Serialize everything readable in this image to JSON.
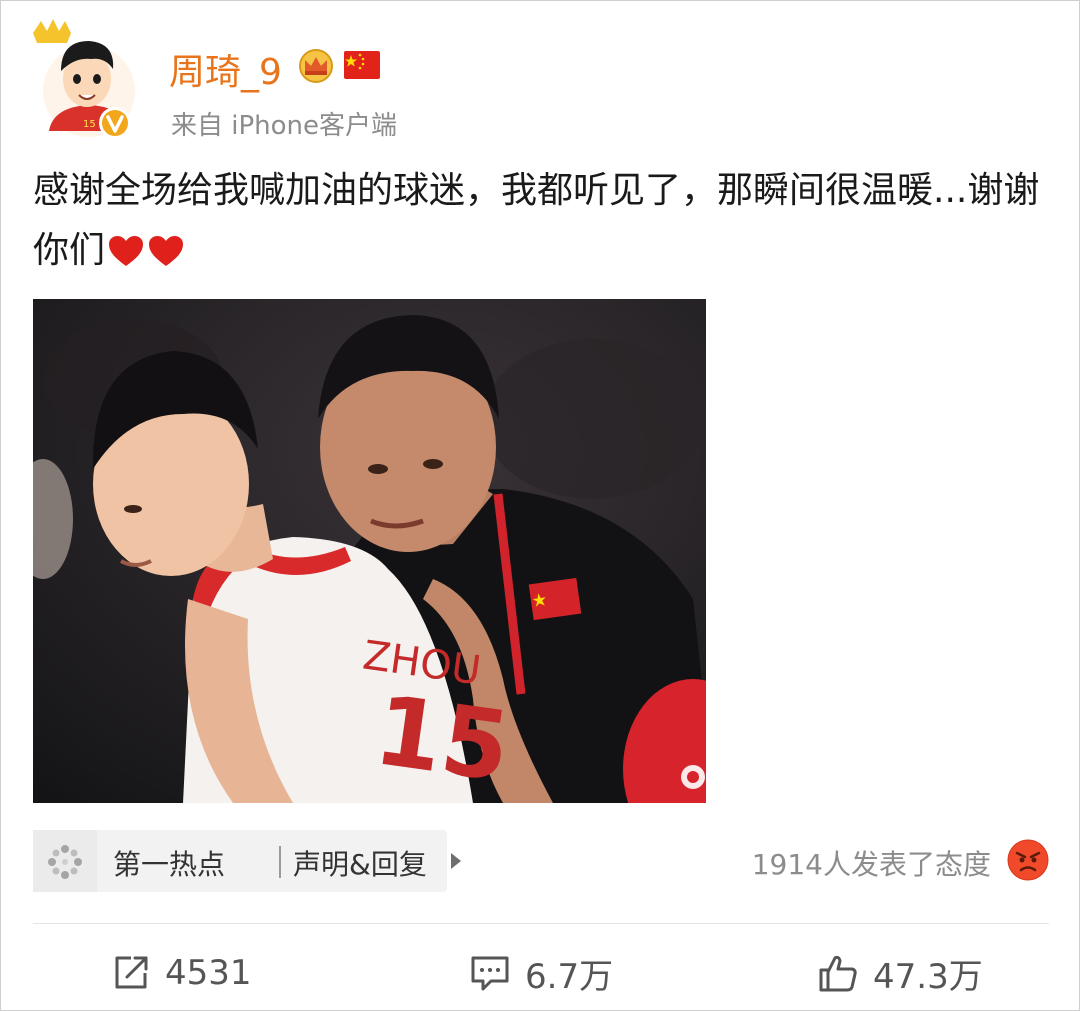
{
  "user": {
    "name": "周琦_9",
    "source": "来自 iPhone客户端"
  },
  "post": {
    "text": "感谢全场给我喊加油的球迷，我都听见了，那瞬间很温暖...谢谢你们"
  },
  "topic": {
    "label": "第一热点",
    "link_label": "声明&回复"
  },
  "reactions": {
    "summary": "1914人发表了态度"
  },
  "actions": {
    "repost_count": "4531",
    "comment_count": "6.7万",
    "like_count": "47.3万"
  },
  "icons": {
    "avatar": "cartoon-avatar",
    "crown": "crown-badge-icon",
    "flag": "china-flag-icon",
    "verified": "verified-v-icon",
    "heart": "heart-emoji-icon",
    "topic": "hotspot-icon",
    "angry": "angry-emoji-icon",
    "repost": "repost-icon",
    "comment": "comment-icon",
    "like": "thumbs-up-icon"
  },
  "colors": {
    "username": "#e8741c",
    "meta": "#8c8c8c",
    "text": "#1a1a1a",
    "heart": "#e0201b"
  }
}
